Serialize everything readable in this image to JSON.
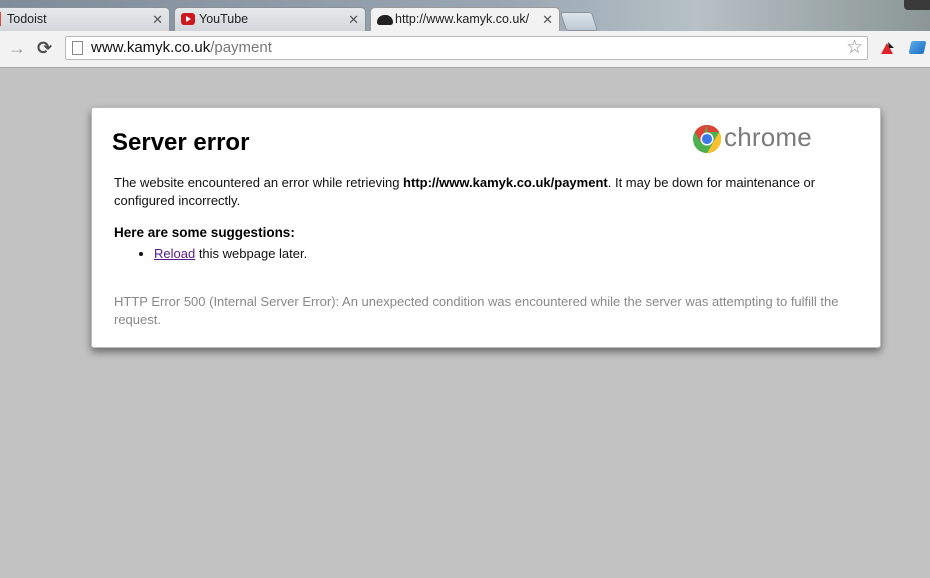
{
  "tabs": [
    {
      "title": "Todoist",
      "close": "✕"
    },
    {
      "title": "YouTube",
      "close": "✕"
    },
    {
      "title": "http://www.kamyk.co.uk/",
      "close": "✕",
      "active": true
    }
  ],
  "toolbar": {
    "forward_icon": "→",
    "reload_icon": "⟳",
    "url_host": "www.kamyk.co.uk",
    "url_path": "/payment",
    "star_icon": "☆"
  },
  "error": {
    "title": "Server error",
    "logo_text": "chrome",
    "desc_before": "The website encountered an error while retrieving ",
    "desc_url": "http://www.kamyk.co.uk/payment",
    "desc_after": ". It may be down for maintenance or configured incorrectly.",
    "suggestions_title": "Here are some suggestions:",
    "reload_link": "Reload",
    "reload_rest": " this webpage later.",
    "http_error": "HTTP Error 500 (Internal Server Error): An unexpected condition was encountered while the server was attempting to fulfill the request."
  },
  "colors": {
    "page_background": "#c2c2c2",
    "link_visited": "#551a8b",
    "muted_text": "#888888"
  }
}
